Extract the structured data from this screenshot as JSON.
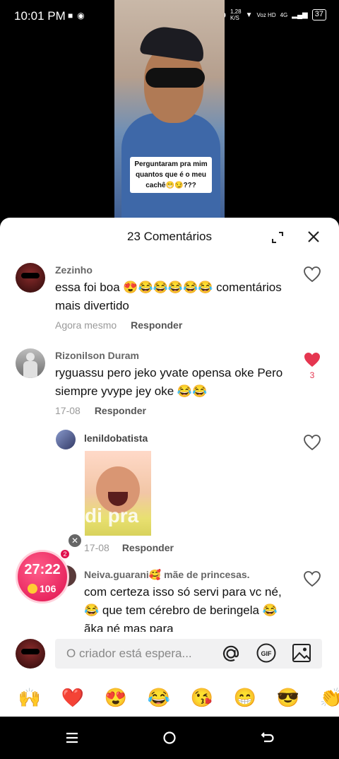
{
  "status": {
    "time": "10:01 PM",
    "speed": "1,28",
    "speed_unit": "K/S",
    "network": "Voz HD",
    "gen": "4G",
    "battery": "37"
  },
  "video": {
    "caption": "Perguntaram pra mim quantos que é o meu cachê😁😏???"
  },
  "sheet": {
    "title": "23 Comentários"
  },
  "comments": [
    {
      "user": "Zezinho",
      "text": "essa foi boa 😍😂😂😂😂😂 comentários mais divertido",
      "time": "Agora mesmo",
      "reply": "Responder"
    },
    {
      "user": "Rizonilson  Duram",
      "text": "ryguassu pero jeko yvate opensa oke Pero siempre yvype jey oke 😂😂",
      "time": "17-08",
      "reply": "Responder",
      "likes": "3"
    },
    {
      "user": "lenildobatista",
      "gif_text": "di pra",
      "time": "17-08",
      "reply": "Responder"
    },
    {
      "user": "Neiva.guarani🥰 mãe de princesas.",
      "text": "com certeza isso só servi para vc né,😂 que tem cérebro de beringela 😂 ãka né mas para"
    }
  ],
  "live": {
    "timer": "27:22",
    "coins": "106",
    "badge": "2"
  },
  "input": {
    "placeholder": "O criador está espera..."
  },
  "emojis": [
    "🙌",
    "❤️",
    "😍",
    "😂",
    "😘",
    "😁",
    "😎",
    "👏"
  ],
  "colors": {
    "like_red": "#e53650",
    "live_pink": "#e0104e"
  }
}
